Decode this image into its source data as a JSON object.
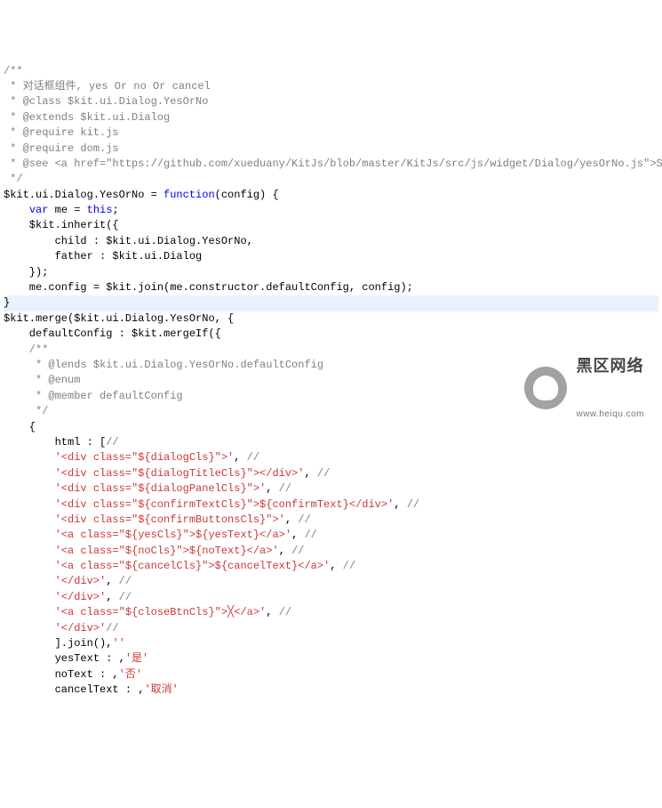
{
  "code": {
    "lines": [
      {
        "cls": "comment",
        "text": "/**"
      },
      {
        "cls": "comment",
        "text": " * 对话框组件, yes Or no Or cancel"
      },
      {
        "cls": "comment",
        "text": " * @class $kit.ui.Dialog.YesOrNo"
      },
      {
        "cls": "comment",
        "text": " * @extends $kit.ui.Dialog"
      },
      {
        "cls": "comment",
        "text": " * @require kit.js"
      },
      {
        "cls": "comment",
        "text": " * @require dom.js"
      },
      {
        "cls": "comment",
        "text": " * @see <a href=\"https://github.com/xueduany/KitJs/blob/master/KitJs/src/js/widget/Dialog/yesOrNo.js\">Source code</a>"
      },
      {
        "cls": "comment",
        "text": " */"
      },
      {
        "cls": "plain",
        "text": "$kit.ui.Dialog.YesOrNo = ",
        "kw": "function",
        "after": "(config) {"
      },
      {
        "cls": "plain",
        "text": "    ",
        "kw": "var",
        "after": " me = ",
        "kw2": "this",
        "after2": ";"
      },
      {
        "cls": "plain",
        "text": "    $kit.inherit({"
      },
      {
        "cls": "plain",
        "text": "        child : $kit.ui.Dialog.YesOrNo,"
      },
      {
        "cls": "plain",
        "text": "        father : $kit.ui.Dialog"
      },
      {
        "cls": "plain",
        "text": "    });"
      },
      {
        "cls": "plain",
        "text": "    me.config = $kit.join(me.constructor.defaultConfig, config);"
      },
      {
        "cls": "hl",
        "text": "}"
      },
      {
        "cls": "plain",
        "text": "$kit.merge($kit.ui.Dialog.YesOrNo, {"
      },
      {
        "cls": "plain",
        "text": "    defaultConfig : $kit.mergeIf({"
      },
      {
        "cls": "comment",
        "text": "    /**"
      },
      {
        "cls": "comment",
        "text": "     * @lends $kit.ui.Dialog.YesOrNo.defaultConfig"
      },
      {
        "cls": "comment",
        "text": "     * @enum"
      },
      {
        "cls": "comment",
        "text": "     * @member defaultConfig"
      },
      {
        "cls": "comment",
        "text": "     */"
      },
      {
        "cls": "plain",
        "text": "    {"
      },
      {
        "cls": "plain",
        "text": "        html : [",
        "comment2": "//"
      },
      {
        "cls": "string",
        "pre": "        ",
        "text": "'<div class=\"${dialogCls}\">'",
        "after": ", ",
        "comment2": "//"
      },
      {
        "cls": "string",
        "pre": "        ",
        "text": "'<div class=\"${dialogTitleCls}\"></div>'",
        "after": ", ",
        "comment2": "//"
      },
      {
        "cls": "string",
        "pre": "        ",
        "text": "'<div class=\"${dialogPanelCls}\">'",
        "after": ", ",
        "comment2": "//"
      },
      {
        "cls": "string",
        "pre": "        ",
        "text": "'<div class=\"${confirmTextCls}\">${confirmText}</div>'",
        "after": ", ",
        "comment2": "//"
      },
      {
        "cls": "string",
        "pre": "        ",
        "text": "'<div class=\"${confirmButtonsCls}\">'",
        "after": ", ",
        "comment2": "//"
      },
      {
        "cls": "string",
        "pre": "        ",
        "text": "'<a class=\"${yesCls}\">${yesText}</a>'",
        "after": ", ",
        "comment2": "//"
      },
      {
        "cls": "string",
        "pre": "        ",
        "text": "'<a class=\"${noCls}\">${noText}</a>'",
        "after": ", ",
        "comment2": "//"
      },
      {
        "cls": "string",
        "pre": "        ",
        "text": "'<a class=\"${cancelCls}\">${cancelText}</a>'",
        "after": ", ",
        "comment2": "//"
      },
      {
        "cls": "string",
        "pre": "        ",
        "text": "'</div>'",
        "after": ", ",
        "comment2": "//"
      },
      {
        "cls": "string",
        "pre": "        ",
        "text": "'</div>'",
        "after": ", ",
        "comment2": "//"
      },
      {
        "cls": "string",
        "pre": "        ",
        "text": "'<a class=\"${closeBtnCls}\">╳</a>'",
        "after": ", ",
        "comment2": "//"
      },
      {
        "cls": "string",
        "pre": "        ",
        "text": "'</div>'",
        "comment2": "//"
      },
      {
        "cls": "plain",
        "text": "        ].join(",
        "str": "''",
        "after": "),"
      },
      {
        "cls": "plain",
        "text": "        yesText : ",
        "str": "'是'",
        "after": ","
      },
      {
        "cls": "plain",
        "text": "        noText : ",
        "str": "'否'",
        "after": ","
      },
      {
        "cls": "plain",
        "text": "        cancelText : ",
        "str": "'取消'",
        "after": ","
      }
    ]
  },
  "watermark": {
    "title": "黑区网络",
    "url": "www.heiqu.com"
  }
}
